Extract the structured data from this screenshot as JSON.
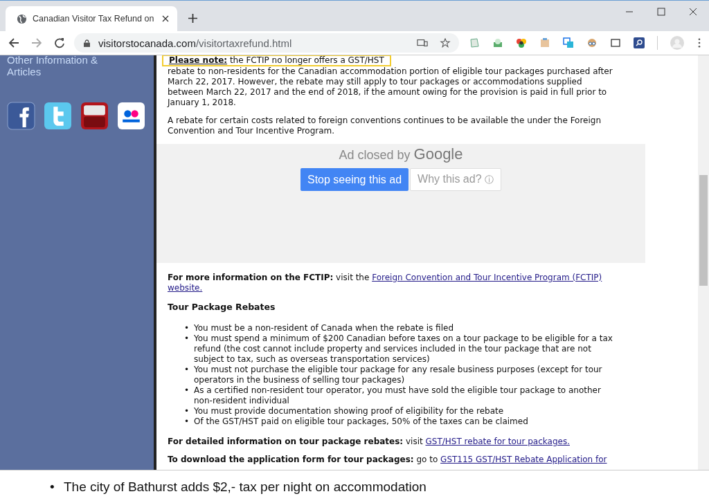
{
  "browser": {
    "tab_title": "Canadian Visitor Tax Refund on",
    "url_domain": "visitorstocanada.com",
    "url_path": "/visitortaxrefund.html"
  },
  "sidebar": {
    "heading": "Other Information & Articles"
  },
  "content": {
    "note_first_line": "**Please note:** the FCTIP no longer offers a GST/HST",
    "note_rest": "rebate to non-residents for the Canadian accommodation portion of eligible tour packages purchased after March 22, 2017. However, the rebate may still apply to tour packages or accommodations supplied between March 22, 2017 and the end of 2018, if the amount owing for the provision is paid in full prior to January 1, 2018.",
    "convention_paragraph": "A rebate for certain costs related to foreign conventions continues to be available the under the Foreign Convention and Tour Incentive Program.",
    "ad": {
      "closed_by": "Ad closed by",
      "brand": "Google",
      "stop_button": "Stop seeing this ad",
      "why_button": "Why this ad?",
      "why_icon": "ⓘ"
    },
    "more_info": {
      "label": "For more information on the FCTIP:",
      "text": "visit the",
      "link": "Foreign Convention and Tour Incentive Program (FCTIP)",
      "link_end": "website."
    },
    "section_title": "Tour Package Rebates",
    "bullet_mark": "•",
    "bullets": [
      "You must be a non-resident of Canada when the rebate is filed",
      "You must spend a minimum of $200 Canadian before taxes on a tour package to be eligible for a tax refund (the cost cannot include property and services included in the tour package that are not subject to tax, such as overseas transportation services)",
      "You must not purchase the eligible tour package for any resale business purposes (except for tour operators in the business of selling tour packages)",
      "As a certified non-resident tour operator, you must have sold the eligible tour package to another non-resident individual",
      "You must provide documentation showing proof of eligibility for the rebate",
      "Of the GST/HST paid on eligible tour packages, 50% of the taxes can be claimed"
    ],
    "detail_info": {
      "label": "For detailed information on tour package rebates:",
      "text": "visit",
      "link": "GST/HST rebate for tour packages."
    },
    "download_info": {
      "label": "To download the application form for tour packages:",
      "text": "go to",
      "link": "GST115 GST/HST Rebate Application for"
    }
  },
  "overlay": {
    "bullet_mark": "•",
    "bullet": "The city of Bathurst adds $2,- tax per night on accommodation"
  }
}
